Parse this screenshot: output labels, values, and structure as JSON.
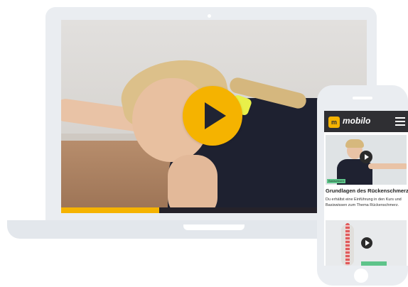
{
  "video": {
    "progress_fraction": 0.32,
    "accent_color": "#f5b300"
  },
  "phone_app": {
    "logo_mark": "m",
    "logo_text": "mobilo",
    "header_color": "#2f2f33",
    "card1": {
      "tag": "Basiswissen",
      "title": "Grundlagen des Rückenschmerz",
      "description": "Du erhältst eine Einführung in den Kurs und Basiswissen zum Thema Rückenschmerz."
    }
  }
}
